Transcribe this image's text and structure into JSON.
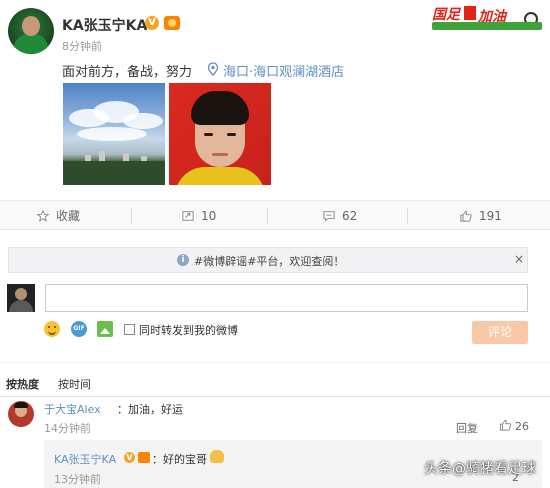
{
  "post": {
    "user_name": "KA张玉宁KA",
    "verified_badge": "V",
    "time": "8分钟前",
    "text": "面对前方，备战，努力",
    "location": "海口·海口观澜湖酒店",
    "images": [
      "sky-photo",
      "portrait-photo"
    ],
    "logo_text_1": "国足",
    "logo_text_2": "加油"
  },
  "actions": {
    "favorite_label": "收藏",
    "repost_count": "10",
    "comment_count": "62",
    "like_count": "191"
  },
  "notice": {
    "icon": "i",
    "text": "#微博辟谣#平台，欢迎查阅！",
    "close": "×"
  },
  "composer": {
    "placeholder": "",
    "checkbox_label": "同时转发到我的微博",
    "submit_label": "评论",
    "gif_label": "GIF"
  },
  "sort": {
    "hot": "按热度",
    "time": "按时间"
  },
  "comments": [
    {
      "user": "于大宝Alex",
      "text": "：加油，好运",
      "time": "14分钟前",
      "reply_label": "回复",
      "likes": "26",
      "replies": [
        {
          "user": "KA张玉宁KA",
          "verified_badge": "V",
          "text": "：好的宝哥",
          "time": "13分钟前",
          "likes": "2"
        }
      ]
    }
  ],
  "watermark": "头条@骑猪看足球",
  "colors": {
    "link": "#5d8fc6",
    "accent": "#ff8200",
    "submit_disabled": "#f9c8a6"
  }
}
